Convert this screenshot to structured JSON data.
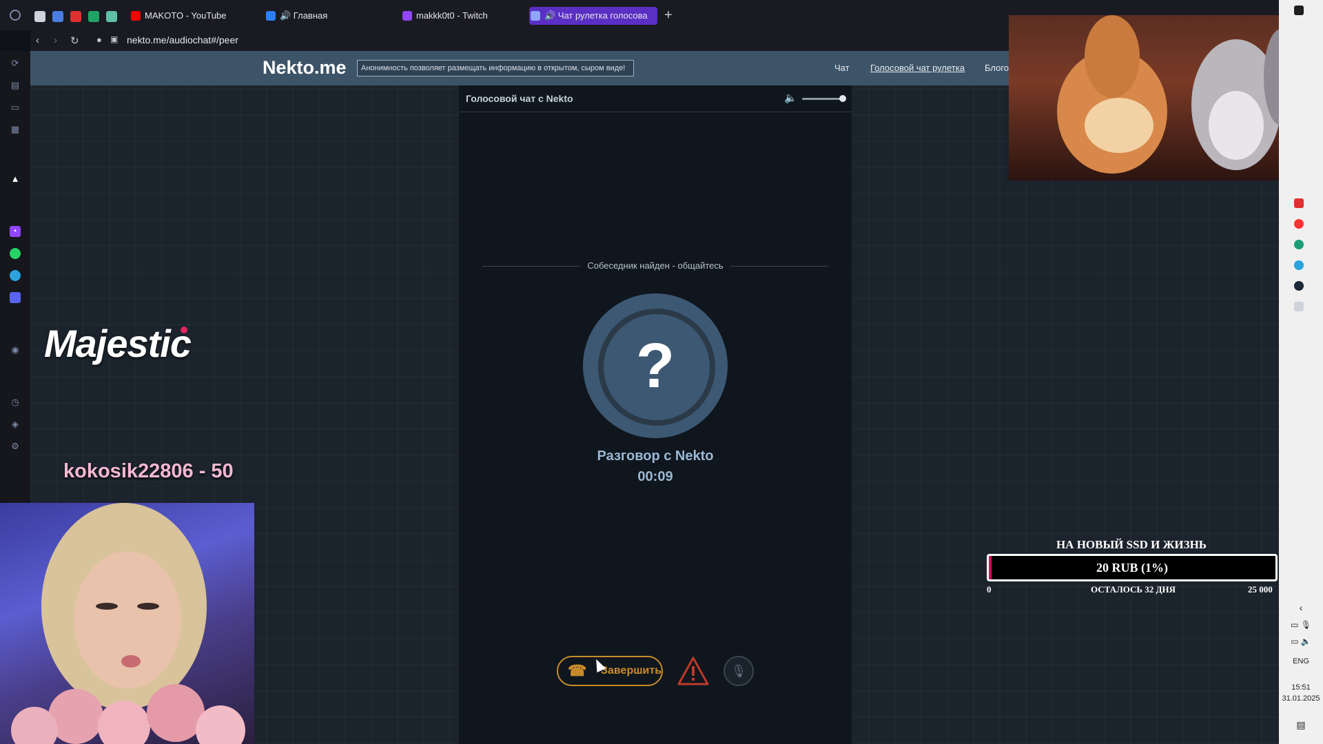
{
  "tabs": [
    {
      "label": "MAKOTO - YouTube",
      "color": "#ff0000"
    },
    {
      "label": "🔊 Главная",
      "color": "#2d7ff9"
    },
    {
      "label": "makkk0t0 - Twitch",
      "color": "#9146ff"
    },
    {
      "label": "🔊 Чат рулетка голосова",
      "color": "#8fa6ff"
    }
  ],
  "new_tab_label": "+",
  "address": {
    "url": "nekto.me/audiochat#/peer"
  },
  "site": {
    "logo": "Nekto.me",
    "slogan": "Анонимность позволяет размещать информацию в открытом, сыром виде!",
    "nav": [
      "Чат",
      "Голосовой чат рулетка",
      "Блого"
    ]
  },
  "chat": {
    "header_title": "Голосовой чат с Nekto",
    "volume_fraction": 0.95,
    "status_text": "Собеседник найден - общайтесь",
    "avatar_symbol": "?",
    "talk_label": "Разговор с Nekto",
    "timer": "00:09",
    "end_button_label": "Завершить"
  },
  "overlays": {
    "brand": "Majestic",
    "ticker": "kokosik22806 - 50"
  },
  "donation": {
    "title": "НА НОВЫЙ SSD И ЖИЗНЬ",
    "amount_label": "20 RUB (1%)",
    "progress_percent": 1,
    "min": "0",
    "remaining": "ОСТАЛОСЬ 32 ДНЯ",
    "max": "25 000"
  },
  "system": {
    "language": "ENG",
    "time": "15:51",
    "date": "31.01.2025"
  },
  "colors": {
    "accent_orange": "#c98c2a",
    "nav_bg": "#3d5468",
    "avatar": "#3c5873",
    "progress": "#c2185b"
  }
}
